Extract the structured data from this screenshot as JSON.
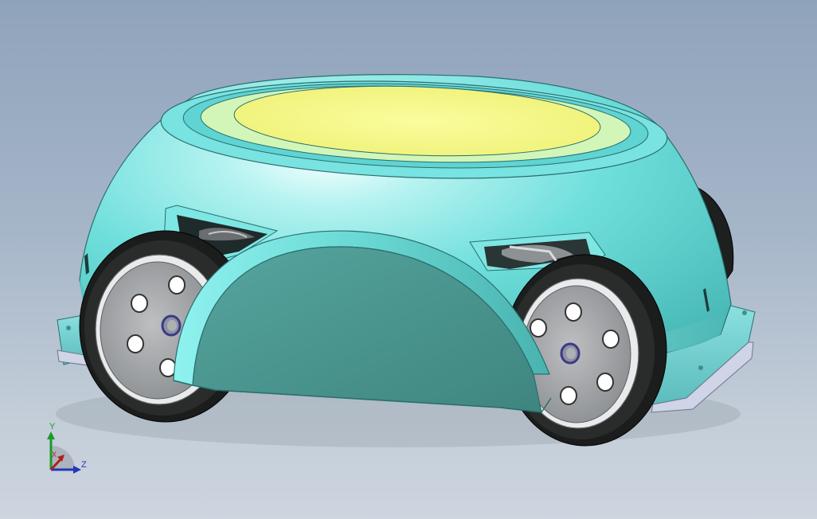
{
  "viewport": {
    "background_top": "#8fa3bb",
    "background_bottom": "#cdd5df"
  },
  "model": {
    "shell_color": "#6fdfdc",
    "top_disc_color": "#f6f78a",
    "fender_color": "#4b938d",
    "base_plate_color": "#7fd6d6",
    "tire_color": "#1b1d1d",
    "hub_color": "#a8abad",
    "hub_ring_color": "#3b3a86"
  },
  "triad": {
    "y_label": "Y",
    "x_label": "X",
    "z_label": "Z",
    "y_color": "#1d9a2a",
    "x_color": "#b01e1e",
    "z_color": "#2236b8"
  }
}
